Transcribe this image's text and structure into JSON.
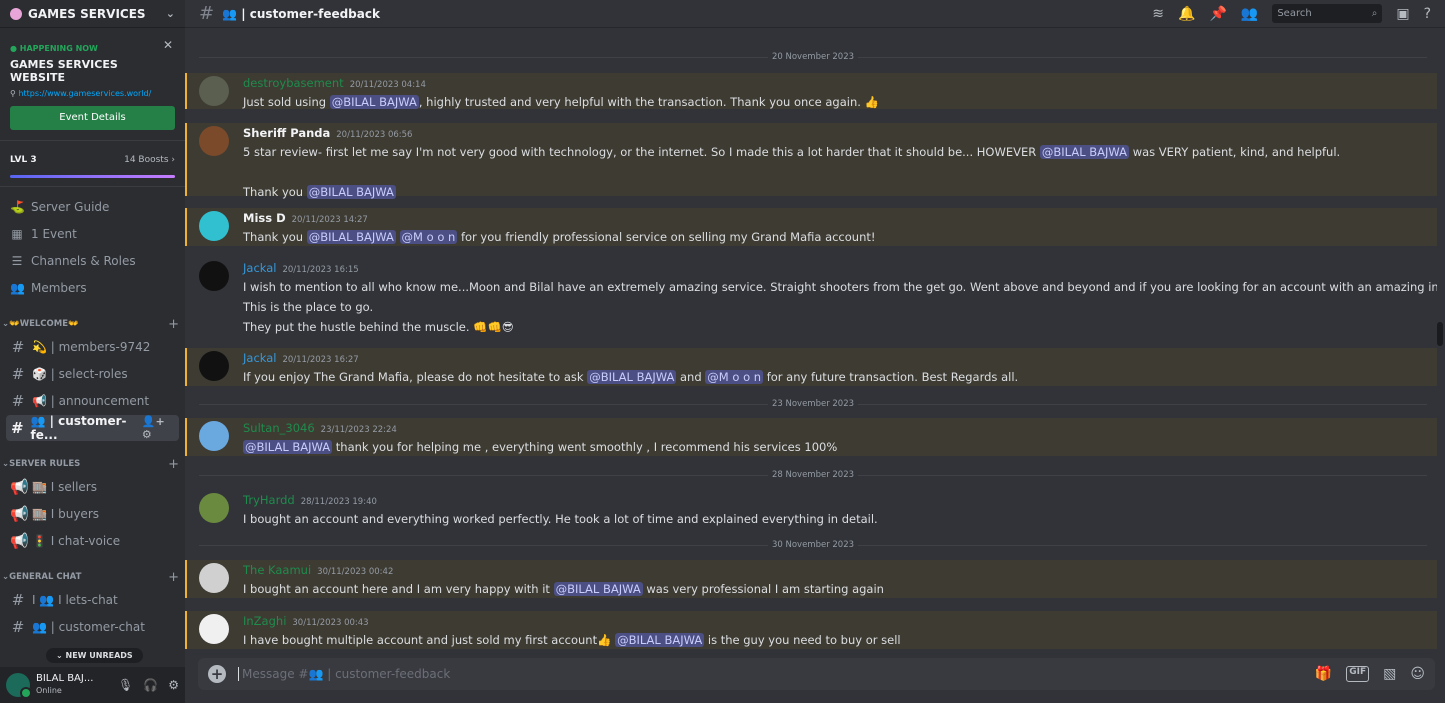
{
  "server": {
    "name": "GAMES SERVICES"
  },
  "event": {
    "status": "HAPPENING NOW",
    "title": "GAMES SERVICES WEBSITE",
    "link": "https://www.gameservices.world/",
    "button": "Event Details"
  },
  "boost": {
    "level": "LVL 3",
    "count": "14 Boosts",
    "progress": 1.0
  },
  "nav": [
    {
      "icon": "⛳",
      "label": "Server Guide"
    },
    {
      "icon": "▦",
      "label": "1 Event"
    },
    {
      "icon": "☰",
      "label": "Channels & Roles"
    },
    {
      "icon": "👥",
      "label": "Members"
    }
  ],
  "categories": [
    {
      "name": "👐WELCOME👐",
      "channels": [
        {
          "icon": "#",
          "label": "💫 | members-9742"
        },
        {
          "icon": "#",
          "label": "🎲 | select-roles"
        },
        {
          "icon": "#",
          "label": "📢 | announcement"
        },
        {
          "icon": "#",
          "label": "👥 | customer-fe...",
          "active": true
        }
      ]
    },
    {
      "name": "SERVER RULES",
      "channels": [
        {
          "icon": "📢",
          "label": "🏬 I sellers"
        },
        {
          "icon": "📢",
          "label": "🏬 I buyers"
        },
        {
          "icon": "📢",
          "label": "🚦 I chat-voice"
        }
      ]
    },
    {
      "name": "GENERAL CHAT",
      "channels": [
        {
          "icon": "#",
          "label": "I 👥 I lets-chat"
        },
        {
          "icon": "#",
          "label": "👥 | customer-chat"
        }
      ]
    }
  ],
  "new_unreads": "NEW UNREADS",
  "user": {
    "name": "BILAL BAJ...",
    "status": "Online"
  },
  "header": {
    "channel": "👥 | customer-feedback",
    "search_placeholder": "Search"
  },
  "composer": {
    "placeholder": "Message #👥 | customer-feedback"
  },
  "colors": {
    "accent": "#5865f2",
    "mention_highlight": "#f0b232",
    "online": "#23a55a"
  },
  "dates": [
    "20 November 2023",
    "23 November 2023",
    "28 November 2023",
    "30 November 2023"
  ],
  "messages": [
    {
      "author": "destroybasement",
      "color": "g",
      "time": "20/11/2023 04:14",
      "hl": true,
      "avatar": "#5a5f50",
      "lines": [
        [
          {
            "t": "Just sold using "
          },
          {
            "m": "@BILAL BAJWA"
          },
          {
            "t": ", highly trusted and very helpful with the transaction. Thank you once again. 👍"
          }
        ]
      ]
    },
    {
      "author": "Sheriff Panda",
      "color": "",
      "time": "20/11/2023 06:56",
      "hl": true,
      "avatar": "#7a4a2a",
      "lines": [
        [
          {
            "t": "5 star review- first let me say I'm not very good with technology, or the internet. So I made this a lot harder that it should be... HOWEVER "
          },
          {
            "m": "@BILAL BAJWA"
          },
          {
            "t": "  was VERY patient, kind, and helpful."
          }
        ],
        [],
        [
          {
            "t": "Thank you "
          },
          {
            "m": "@BILAL BAJWA"
          }
        ]
      ]
    },
    {
      "author": "Miss D",
      "color": "",
      "time": "20/11/2023 14:27",
      "hl": true,
      "avatar": "#30c0d0",
      "lines": [
        [
          {
            "t": "Thank you "
          },
          {
            "m": "@BILAL BAJWA"
          },
          {
            "t": " "
          },
          {
            "m": "@M o o n"
          },
          {
            "t": " for you friendly professional service on selling my Grand Mafia account!"
          }
        ]
      ]
    },
    {
      "author": "Jackal",
      "color": "b",
      "time": "20/11/2023 16:15",
      "hl": false,
      "avatar": "#111111",
      "lines": [
        [
          {
            "t": "I wish to mention to all who know me...Moon and Bilal have an extremely amazing service. Straight shooters from the get go. Went above and beyond and if you are looking for an account with an amazing intermediary."
          }
        ],
        [
          {
            "t": "This is the place to go."
          }
        ],
        [
          {
            "t": "They put the hustle behind the muscle. 👊👊😎"
          }
        ]
      ]
    },
    {
      "author": "Jackal",
      "color": "b",
      "time": "20/11/2023 16:27",
      "hl": true,
      "avatar": "#111111",
      "lines": [
        [
          {
            "t": "If you enjoy The Grand Mafia, please do not hesitate to ask "
          },
          {
            "m": "@BILAL BAJWA"
          },
          {
            "t": " and "
          },
          {
            "m": "@M o o n"
          },
          {
            "t": " for any future transaction. Best Regards all."
          }
        ]
      ]
    },
    {
      "author": "Sultan_3046",
      "color": "g",
      "time": "23/11/2023 22:24",
      "hl": true,
      "avatar": "#6aa8e0",
      "lines": [
        [
          {
            "m": "@BILAL BAJWA"
          },
          {
            "t": " thank you for helping me , everything went smoothly , I recommend his services 100%"
          }
        ]
      ]
    },
    {
      "author": "TryHardd",
      "color": "g",
      "time": "28/11/2023 19:40",
      "hl": false,
      "avatar": "#6a8a40",
      "lines": [
        [
          {
            "t": "I bought an account and everything worked perfectly. He took a lot of time and explained everything in detail."
          }
        ]
      ]
    },
    {
      "author": "The Kaamui",
      "color": "g",
      "time": "30/11/2023 00:42",
      "hl": true,
      "avatar": "#d0d0d0",
      "lines": [
        [
          {
            "t": "I bought an account here and I am very happy with it "
          },
          {
            "m": "@BILAL BAJWA"
          },
          {
            "t": "  was very professional I am starting again"
          }
        ]
      ]
    },
    {
      "author": "InZaghi",
      "color": "g",
      "time": "30/11/2023 00:43",
      "hl": true,
      "avatar": "#f0f0f0",
      "lines": [
        [
          {
            "t": "I have bought multiple account and just sold my first account👍 "
          },
          {
            "m": "@BILAL BAJWA"
          },
          {
            "t": " is the guy you need to buy or sell"
          }
        ]
      ]
    }
  ]
}
